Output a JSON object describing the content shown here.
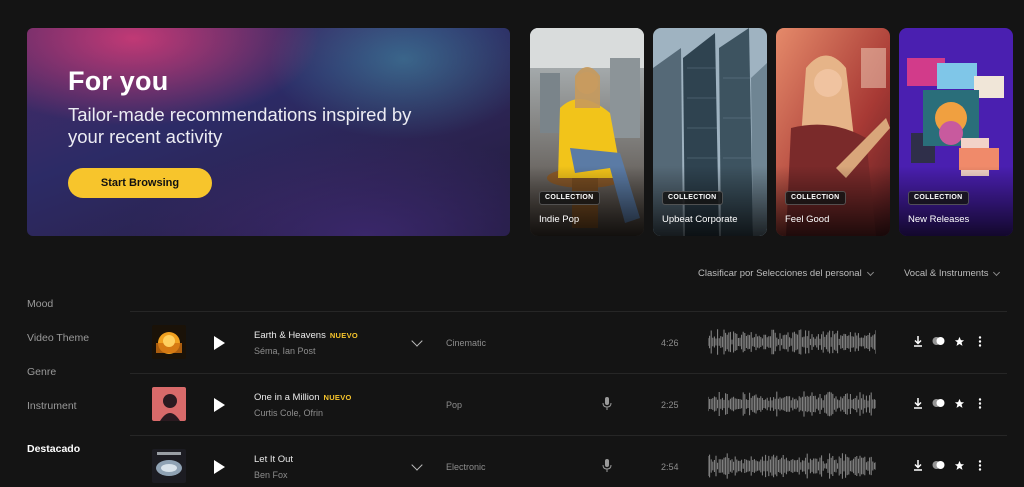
{
  "hero": {
    "title": "For you",
    "subtitle": "Tailor-made recommendations inspired by your recent activity",
    "button_label": "Start Browsing"
  },
  "collections": [
    {
      "badge": "COLLECTION",
      "name": "Indie Pop"
    },
    {
      "badge": "COLLECTION",
      "name": "Upbeat Corporate"
    },
    {
      "badge": "COLLECTION",
      "name": "Feel Good"
    },
    {
      "badge": "COLLECTION",
      "name": "New Releases"
    }
  ],
  "filters": {
    "sort_label": "Clasificar por Selecciones del personal",
    "vocal_label": "Vocal & Instruments"
  },
  "sidebar": {
    "items": [
      "Mood",
      "Video Theme",
      "Genre",
      "Instrument",
      "Destacado"
    ],
    "active": "Destacado"
  },
  "tracks": [
    {
      "title": "Earth & Heavens",
      "badge": "NUEVO",
      "artist": "Séma, Ian Post",
      "genre": "Cinematic",
      "duration": "4:26",
      "has_vocals": false,
      "has_versions": true
    },
    {
      "title": "One in a Million",
      "badge": "NUEVO",
      "artist": "Curtis Cole, Ofrin",
      "genre": "Pop",
      "duration": "2:25",
      "has_vocals": true,
      "has_versions": false
    },
    {
      "title": "Let It Out",
      "badge": "",
      "artist": "Ben Fox",
      "genre": "Electronic",
      "duration": "2:54",
      "has_vocals": true,
      "has_versions": true
    }
  ],
  "colors": {
    "accent": "#f7c52c",
    "background": "#141414"
  }
}
